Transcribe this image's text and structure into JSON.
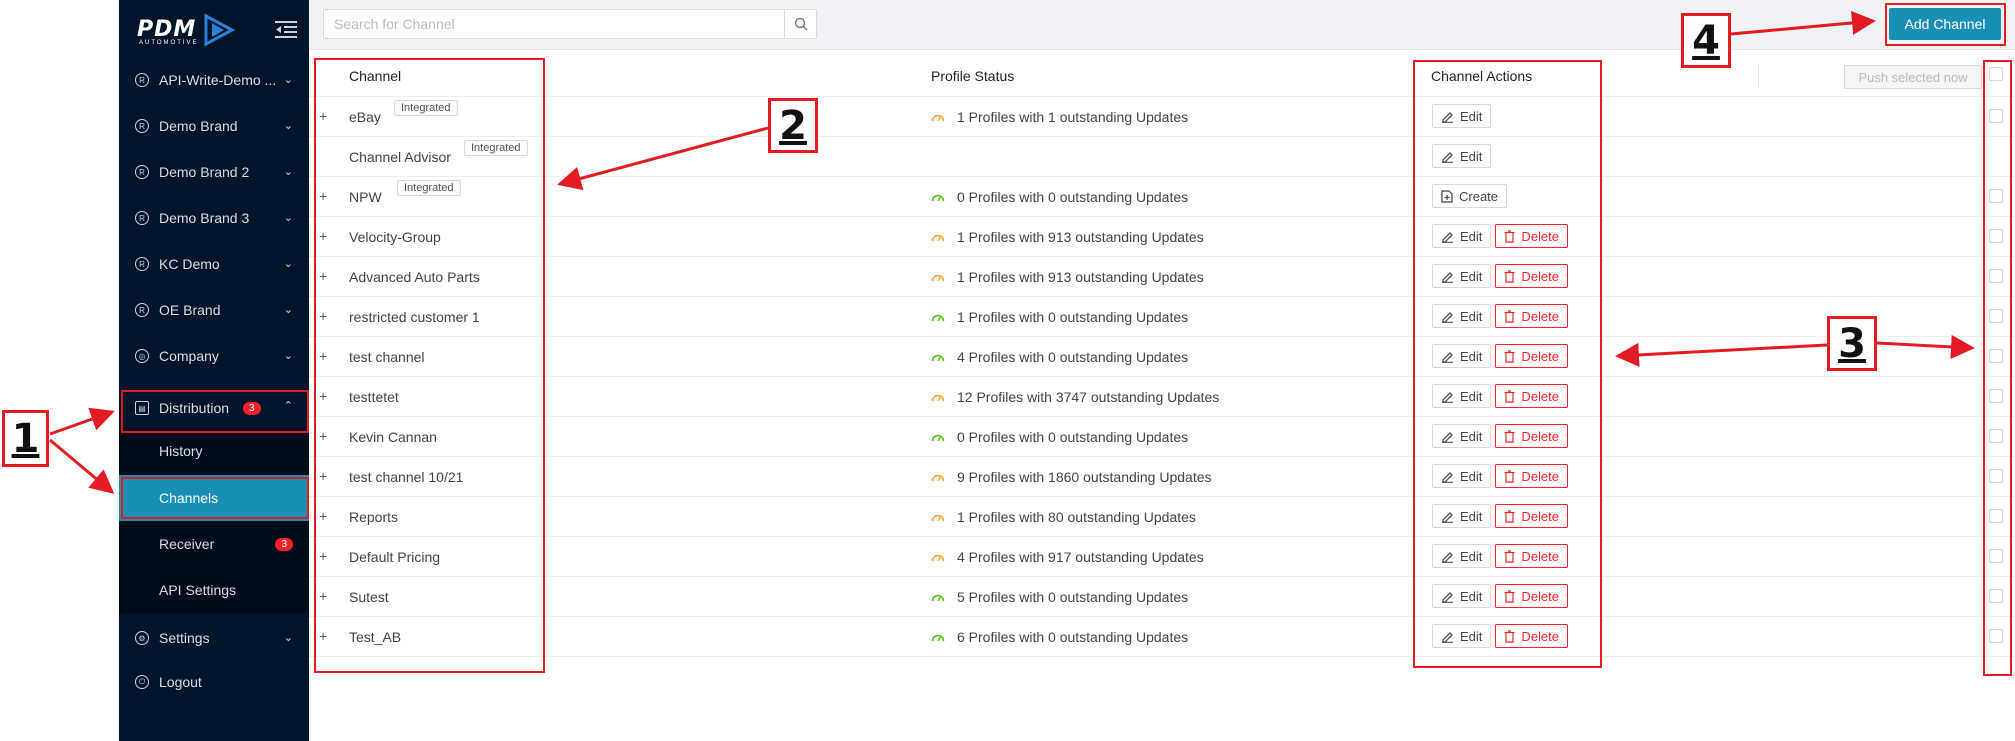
{
  "sidebar": {
    "logo_text": "PDM",
    "logo_sub": "AUTOMOTIVE",
    "items": [
      {
        "label": "API-Write-Demo ...",
        "icon": "registered-icon"
      },
      {
        "label": "Demo Brand",
        "icon": "registered-icon"
      },
      {
        "label": "Demo Brand 2",
        "icon": "registered-icon"
      },
      {
        "label": "Demo Brand 3",
        "icon": "registered-icon"
      },
      {
        "label": "KC Demo",
        "icon": "registered-icon"
      },
      {
        "label": "OE Brand",
        "icon": "registered-icon"
      },
      {
        "label": "Company",
        "icon": "globe-icon"
      },
      {
        "label": "Distribution",
        "icon": "distribution-icon",
        "badge": "3"
      }
    ],
    "sub_items": [
      {
        "label": "History"
      },
      {
        "label": "Channels"
      },
      {
        "label": "Receiver",
        "badge": "3"
      },
      {
        "label": "API Settings"
      }
    ],
    "settings_label": "Settings",
    "logout_label": "Logout"
  },
  "topbar": {
    "search_placeholder": "Search for Channel",
    "add_channel_label": "Add Channel"
  },
  "table": {
    "headers": {
      "channel": "Channel",
      "status": "Profile Status",
      "actions": "Channel Actions"
    },
    "push_label": "Push selected now",
    "tag_label": "Integrated",
    "edit_label": "Edit",
    "delete_label": "Delete",
    "create_label": "Create",
    "rows": [
      {
        "name": "eBay",
        "tag": "Integrated",
        "status": "1 Profiles with 1 outstanding Updates",
        "state": "orange",
        "actions": "edit"
      },
      {
        "name": "Channel Advisor",
        "tag": "Integrated",
        "status": "",
        "state": "none",
        "actions": "edit"
      },
      {
        "name": "NPW",
        "tag": "Integrated",
        "status": "0 Profiles with 0 outstanding Updates",
        "state": "green",
        "actions": "create"
      },
      {
        "name": "Velocity-Group",
        "status": "1 Profiles with 913 outstanding Updates",
        "state": "orange",
        "actions": "edit-delete"
      },
      {
        "name": "Advanced Auto Parts",
        "status": "1 Profiles with 913 outstanding Updates",
        "state": "orange",
        "actions": "edit-delete"
      },
      {
        "name": "restricted customer 1",
        "status": "1 Profiles with 0 outstanding Updates",
        "state": "green",
        "actions": "edit-delete"
      },
      {
        "name": "test channel",
        "status": "4 Profiles with 0 outstanding Updates",
        "state": "green",
        "actions": "edit-delete"
      },
      {
        "name": "testtetet",
        "status": "12 Profiles with 3747 outstanding Updates",
        "state": "orange",
        "actions": "edit-delete"
      },
      {
        "name": "Kevin Cannan",
        "status": "0 Profiles with 0 outstanding Updates",
        "state": "green",
        "actions": "edit-delete"
      },
      {
        "name": "test channel 10/21",
        "status": "9 Profiles with 1860 outstanding Updates",
        "state": "orange",
        "actions": "edit-delete"
      },
      {
        "name": "Reports",
        "status": "1 Profiles with 80 outstanding Updates",
        "state": "orange",
        "actions": "edit-delete"
      },
      {
        "name": "Default Pricing",
        "status": "4 Profiles with 917 outstanding Updates",
        "state": "orange",
        "actions": "edit-delete"
      },
      {
        "name": "Sutest",
        "status": "5 Profiles with 0 outstanding Updates",
        "state": "green",
        "actions": "edit-delete"
      },
      {
        "name": "Test_AB",
        "status": "6 Profiles with 0 outstanding Updates",
        "state": "green",
        "actions": "edit-delete"
      }
    ]
  },
  "annotations": {
    "n1": "1",
    "n2": "2",
    "n3": "3",
    "n4": "4"
  },
  "colors": {
    "accent": "#1a8fb5",
    "sidebar": "#001529",
    "annotation": "#e31b23",
    "warning": "#f0a53a",
    "ok": "#52c41a"
  }
}
